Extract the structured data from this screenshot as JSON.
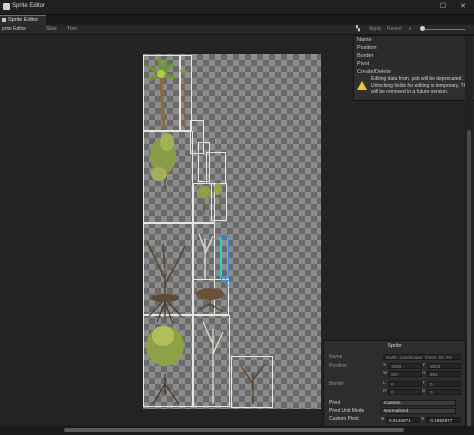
{
  "window": {
    "title": "Sprite Editor"
  },
  "tab": {
    "label": "Sprite Editor"
  },
  "toolbar": {
    "mode_label": "prite Editor",
    "slice_label": "Slice",
    "trim_label": "Trim",
    "apply_label": "Apply",
    "revert_label": "Revert"
  },
  "side_panel": {
    "rows": [
      "Name",
      "Position",
      "Border",
      "Pivot",
      "Create/Delete"
    ],
    "warning": "Editing data from .psb will be deprecated. Unlocking fields for editing is temporary. This will be removed in a future version."
  },
  "sprite_panel": {
    "title": "Sprite",
    "name_label": "Name",
    "name_value": "Earth_Landscape_Trees_03_Fe",
    "position_label": "Position",
    "x_label": "X",
    "x_value": "1690",
    "y_label": "Y",
    "y_value": "3023",
    "w_label": "W",
    "w_value": "257",
    "h_label": "H",
    "h_value": "884",
    "border_label": "Border",
    "l_label": "L",
    "l_value": "0",
    "t_label": "T",
    "t_value": "0",
    "r_label": "R",
    "r_value": "0",
    "b_label": "B",
    "b_value": "0",
    "pivot_label": "Pivot",
    "pivot_value": "Custom",
    "pivot_unit_label": "Pivot Unit Mode",
    "pivot_unit_value": "Normalized",
    "custom_pivot_label": "Custom Pivot",
    "cx_label": "X",
    "cx_value": "0.9146971",
    "cy_label": "Y",
    "cy_value": "-0.1882877"
  },
  "colors": {
    "accent": "#3c8be0",
    "warning": "#f2c335",
    "gizmo": "#2ad2c9"
  }
}
